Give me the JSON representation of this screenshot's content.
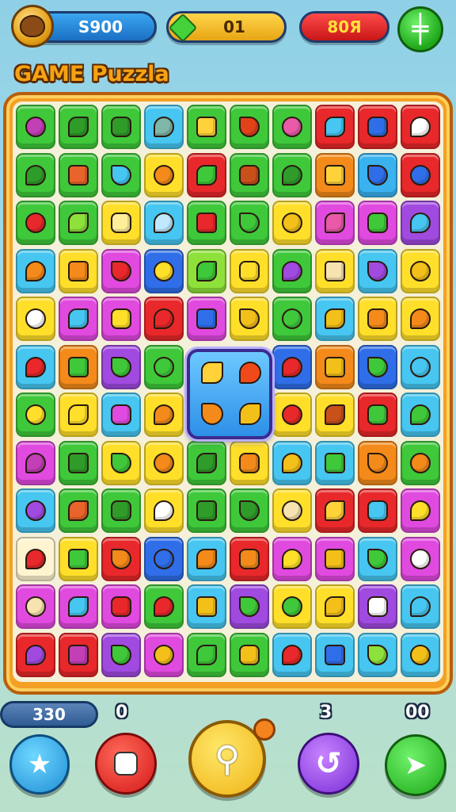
{
  "hud": {
    "coins": "S900",
    "gems": "01",
    "lives": "80Я",
    "settings_icon": "plus-grid-icon"
  },
  "title": "GAME Puzzla",
  "board": {
    "rows": 13,
    "cols": 10,
    "tiles": [
      [
        "#3fc83a",
        "#3fc83a",
        "#3fc83a",
        "#46c6f0",
        "#3fc83a",
        "#3fc83a",
        "#3fc83a",
        "#e8282a",
        "#e8282a",
        "#e8282a"
      ],
      [
        "#3fc83a",
        "#3fc83a",
        "#3fc83a",
        "#ffdf2a",
        "#e8282a",
        "#3fc83a",
        "#3fc83a",
        "#f38a1a",
        "#3ab2f0",
        "#e8282a"
      ],
      [
        "#3fc83a",
        "#3fc83a",
        "#ffdf2a",
        "#46c6f0",
        "#3fc83a",
        "#3fc83a",
        "#ffdf2a",
        "#e04adf",
        "#e04adf",
        "#a04ae0"
      ],
      [
        "#46c6f0",
        "#ffdf2a",
        "#e04adf",
        "#2f6ee8",
        "#8ee03a",
        "#ffdf2a",
        "#3fc83a",
        "#ffdf2a",
        "#46c6f0",
        "#ffdf2a"
      ],
      [
        "#ffdf2a",
        "#e04adf",
        "#e04adf",
        "#e8282a",
        "#e04adf",
        "#ffdf2a",
        "#3fc83a",
        "#46c6f0",
        "#ffdf2a",
        "#ffdf2a"
      ],
      [
        "#46c6f0",
        "#f38a1a",
        "#a04ae0",
        "#3fc83a",
        "#3ab2f0",
        "#3ab2f0",
        "#2f6ee8",
        "#f38a1a",
        "#2f6ee8",
        "#46c6f0"
      ],
      [
        "#3fc83a",
        "#ffdf2a",
        "#46c6f0",
        "#ffdf2a",
        "#3ab2f0",
        "#3ab2f0",
        "#ffdf2a",
        "#ffdf2a",
        "#e8282a",
        "#46c6f0"
      ],
      [
        "#e04adf",
        "#3fc83a",
        "#ffdf2a",
        "#ffdf2a",
        "#3fc83a",
        "#ffdf2a",
        "#46c6f0",
        "#46c6f0",
        "#f38a1a",
        "#3fc83a"
      ],
      [
        "#46c6f0",
        "#3fc83a",
        "#3fc83a",
        "#ffdf2a",
        "#3fc83a",
        "#3fc83a",
        "#ffdf2a",
        "#e8282a",
        "#e8282a",
        "#e04adf"
      ],
      [
        "#fff4d0",
        "#ffdf2a",
        "#e8282a",
        "#2f6ee8",
        "#46c6f0",
        "#e8282a",
        "#e04adf",
        "#e04adf",
        "#46c6f0",
        "#e04adf"
      ],
      [
        "#e04adf",
        "#e04adf",
        "#e04adf",
        "#3fc83a",
        "#46c6f0",
        "#a04ae0",
        "#ffdf2a",
        "#ffdf2a",
        "#a04ae0",
        "#46c6f0"
      ],
      [
        "#e8282a",
        "#e8282a",
        "#a04ae0",
        "#e04adf",
        "#3fc83a",
        "#3fc83a",
        "#46c6f0",
        "#46c6f0",
        "#46c6f0",
        "#46c6f0"
      ]
    ],
    "icons": [
      [
        "#c23fb5",
        "#2f9c2a",
        "#2f9c2a",
        "#7fb8a8",
        "#ffd23a",
        "#e2421a",
        "#e85aa8",
        "#46c6f0",
        "#2f6ee8",
        "#ffffff"
      ],
      [
        "#2f9c2a",
        "#e8642a",
        "#46c6f0",
        "#f38a1a",
        "#3fc83a",
        "#c8501a",
        "#2f9c2a",
        "#ffd23a",
        "#2f6ee8",
        "#2f6ee8"
      ],
      [
        "#e8282a",
        "#8ee03a",
        "#ffef9a",
        "#bfe8ff",
        "#e8282a",
        "#3fc83a",
        "#f3c01a",
        "#e85aa8",
        "#3fc83a",
        "#46c6f0"
      ],
      [
        "#f38a1a",
        "#f38a1a",
        "#e8282a",
        "#ffdf2a",
        "#3fc83a",
        "#ffdf2a",
        "#a04ae0",
        "#f7e3b0",
        "#a04ae0",
        "#f3c01a"
      ],
      [
        "#ffffff",
        "#46c6f0",
        "#ffdf2a",
        "#e8282a",
        "#2f6ee8",
        "#f3c01a",
        "#3fc83a",
        "#f3c01a",
        "#f38a1a",
        "#f38a1a"
      ],
      [
        "#e8282a",
        "#3fc83a",
        "#3fc83a",
        "#3fc83a",
        "#ffd23a",
        "#e8282a",
        "#e8282a",
        "#f3c01a",
        "#3fc83a",
        "#46c6f0"
      ],
      [
        "#ffdf2a",
        "#ffdf2a",
        "#e04adf",
        "#f38a1a",
        "#ffd23a",
        "#f38a1a",
        "#e8282a",
        "#c8501a",
        "#3fc83a",
        "#3fc83a"
      ],
      [
        "#c23fb5",
        "#2f9c2a",
        "#3fc83a",
        "#f38a1a",
        "#2f9c2a",
        "#f38a1a",
        "#f3c01a",
        "#3fc83a",
        "#f38a1a",
        "#f38a1a"
      ],
      [
        "#a04ae0",
        "#e8642a",
        "#2f9c2a",
        "#ffffff",
        "#2f9c2a",
        "#2f9c2a",
        "#f7e3b0",
        "#ffd23a",
        "#46c6f0",
        "#ffdf2a"
      ],
      [
        "#e8282a",
        "#3fc83a",
        "#f38a1a",
        "#2f6ee8",
        "#f38a1a",
        "#f38a1a",
        "#ffdf2a",
        "#f3c01a",
        "#3fc83a",
        "#ffffff"
      ],
      [
        "#f7e3b0",
        "#46c6f0",
        "#e8282a",
        "#e8282a",
        "#f3c01a",
        "#3fc83a",
        "#3fc83a",
        "#f3c01a",
        "#ffffff",
        "#46c6f0"
      ],
      [
        "#a04ae0",
        "#c23fb5",
        "#3fc83a",
        "#f3c01a",
        "#3fc83a",
        "#f3c01a",
        "#e8282a",
        "#2f6ee8",
        "#8ee03a",
        "#f3c01a"
      ]
    ]
  },
  "bottom": {
    "moves": "330",
    "counts": [
      "0",
      "3",
      "00"
    ],
    "buttons": [
      {
        "name": "star-icon"
      },
      {
        "name": "card-icon"
      },
      {
        "name": "magnifier-icon"
      },
      {
        "name": "swirl-icon"
      },
      {
        "name": "bird-icon"
      }
    ]
  }
}
